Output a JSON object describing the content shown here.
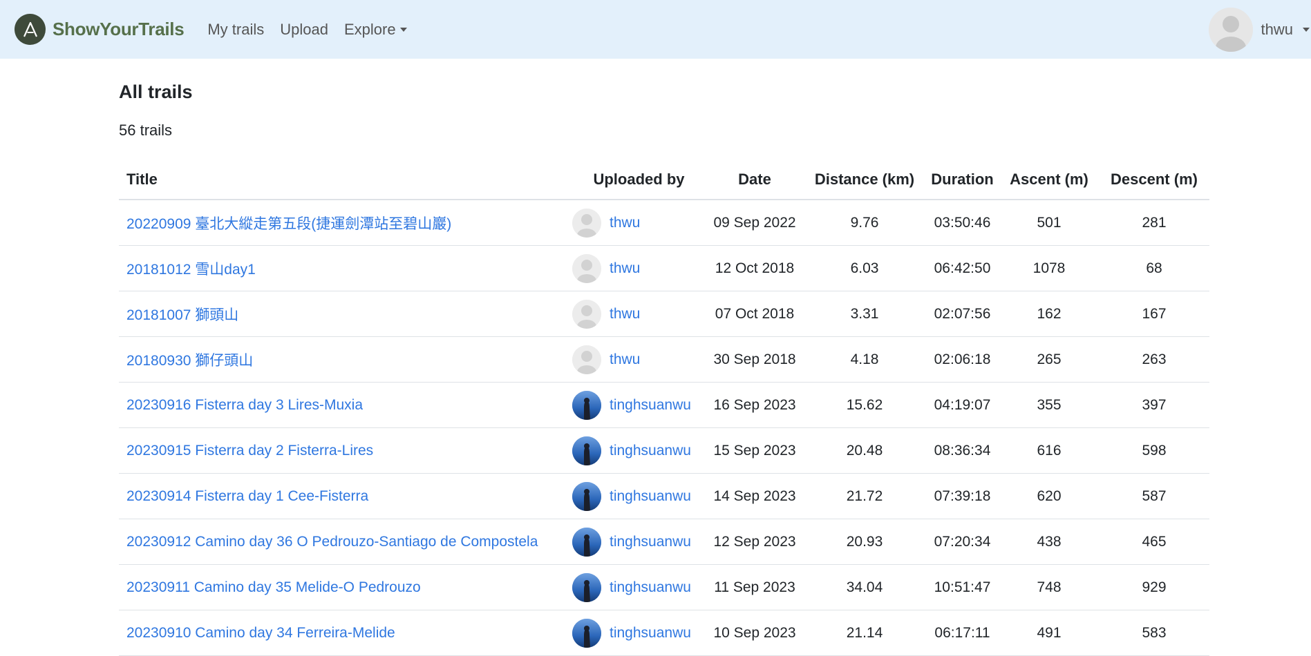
{
  "app": {
    "brand_name": "ShowYourTrails",
    "nav": [
      {
        "label": "My trails"
      },
      {
        "label": "Upload"
      },
      {
        "label": "Explore"
      }
    ],
    "user": {
      "name": "thwu"
    }
  },
  "page": {
    "title": "All trails",
    "count_text": "56 trails"
  },
  "table": {
    "headers": {
      "title": "Title",
      "uploaded_by": "Uploaded by",
      "date": "Date",
      "distance": "Distance (km)",
      "duration": "Duration",
      "ascent": "Ascent (m)",
      "descent": "Descent (m)"
    },
    "rows": [
      {
        "title": "20220909 臺北大縱走第五段(捷運劍潭站至碧山巖)",
        "uploader": "thwu",
        "avatar": "default",
        "date": "09 Sep 2022",
        "distance": "9.76",
        "duration": "03:50:46",
        "ascent": "501",
        "descent": "281"
      },
      {
        "title": "20181012 雪山day1",
        "uploader": "thwu",
        "avatar": "default",
        "date": "12 Oct 2018",
        "distance": "6.03",
        "duration": "06:42:50",
        "ascent": "1078",
        "descent": "68"
      },
      {
        "title": "20181007 獅頭山",
        "uploader": "thwu",
        "avatar": "default",
        "date": "07 Oct 2018",
        "distance": "3.31",
        "duration": "02:07:56",
        "ascent": "162",
        "descent": "167"
      },
      {
        "title": "20180930 獅仔頭山",
        "uploader": "thwu",
        "avatar": "default",
        "date": "30 Sep 2018",
        "distance": "4.18",
        "duration": "02:06:18",
        "ascent": "265",
        "descent": "263"
      },
      {
        "title": "20230916 Fisterra day 3 Lires-Muxia",
        "uploader": "tinghsuanwu",
        "avatar": "photo",
        "date": "16 Sep 2023",
        "distance": "15.62",
        "duration": "04:19:07",
        "ascent": "355",
        "descent": "397"
      },
      {
        "title": "20230915 Fisterra day 2 Fisterra-Lires",
        "uploader": "tinghsuanwu",
        "avatar": "photo",
        "date": "15 Sep 2023",
        "distance": "20.48",
        "duration": "08:36:34",
        "ascent": "616",
        "descent": "598"
      },
      {
        "title": "20230914 Fisterra day 1 Cee-Fisterra",
        "uploader": "tinghsuanwu",
        "avatar": "photo",
        "date": "14 Sep 2023",
        "distance": "21.72",
        "duration": "07:39:18",
        "ascent": "620",
        "descent": "587"
      },
      {
        "title": "20230912 Camino day 36 O Pedrouzo-Santiago de Compostela",
        "uploader": "tinghsuanwu",
        "avatar": "photo",
        "date": "12 Sep 2023",
        "distance": "20.93",
        "duration": "07:20:34",
        "ascent": "438",
        "descent": "465"
      },
      {
        "title": "20230911 Camino day 35 Melide-O Pedrouzo",
        "uploader": "tinghsuanwu",
        "avatar": "photo",
        "date": "11 Sep 2023",
        "distance": "34.04",
        "duration": "10:51:47",
        "ascent": "748",
        "descent": "929"
      },
      {
        "title": "20230910 Camino day 34 Ferreira-Melide",
        "uploader": "tinghsuanwu",
        "avatar": "photo",
        "date": "10 Sep 2023",
        "distance": "21.14",
        "duration": "06:17:11",
        "ascent": "491",
        "descent": "583"
      }
    ]
  }
}
